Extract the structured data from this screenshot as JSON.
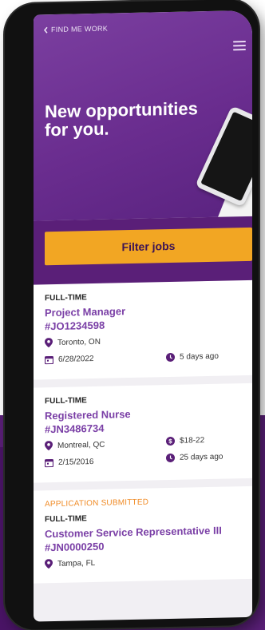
{
  "header": {
    "back_label": "FIND ME WORK",
    "title": "New opportunities for you."
  },
  "filter": {
    "label": "Filter jobs"
  },
  "jobs": [
    {
      "type": "FULL-TIME",
      "title": "Project Manager",
      "id": "#JO1234598",
      "location": "Toronto, ON",
      "date": "6/28/2022",
      "posted": "5 days ago"
    },
    {
      "type": "FULL-TIME",
      "title": "Registered Nurse",
      "id": "#JN3486734",
      "location": "Montreal, QC",
      "pay": "$18-22",
      "date": "2/15/2016",
      "posted": "25 days ago"
    },
    {
      "status": "APPLICATION SUBMITTED",
      "type": "FULL-TIME",
      "title": "Customer Service Representative III",
      "id": "#JN0000250",
      "location": "Tampa, FL"
    }
  ],
  "colors": {
    "brand_purple": "#6a2d8f",
    "accent_orange": "#f2a623",
    "status_orange": "#f08a24"
  }
}
